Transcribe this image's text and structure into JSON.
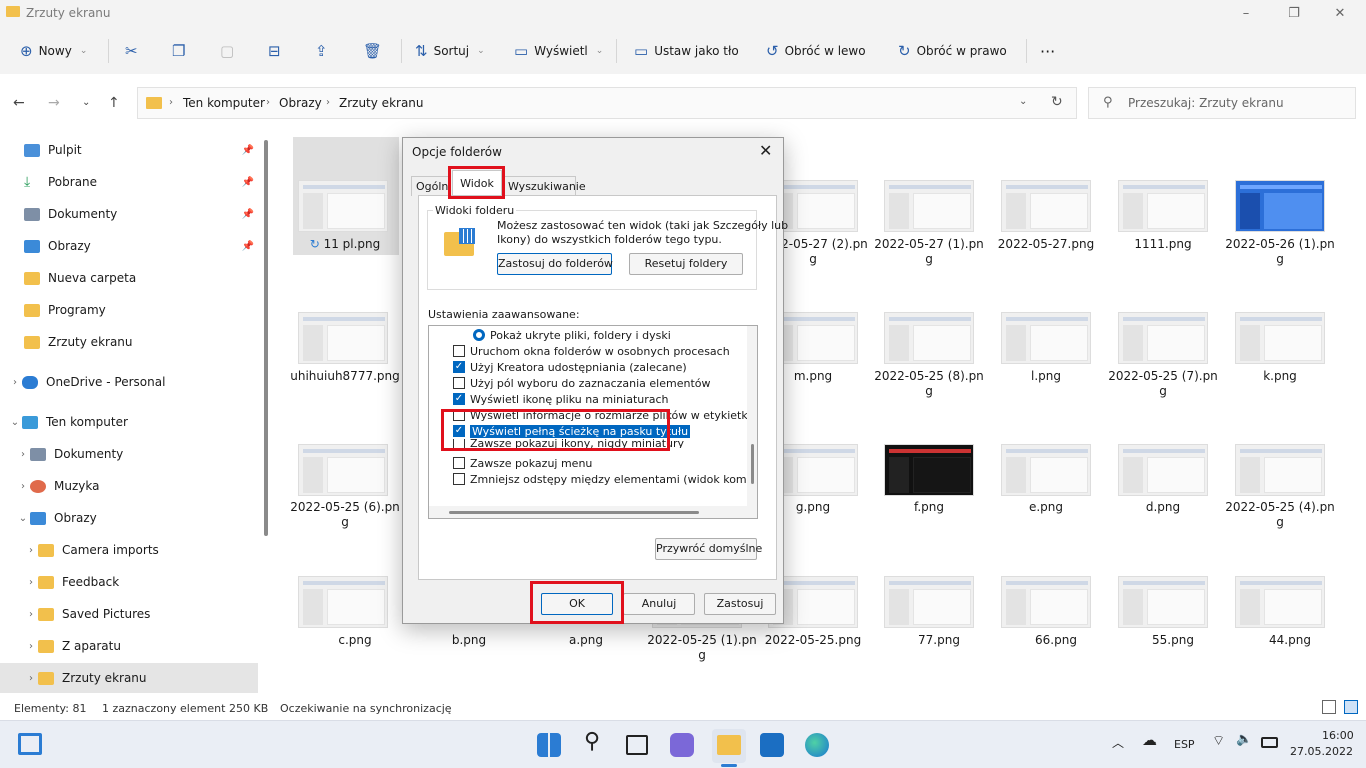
{
  "window": {
    "title": "Zrzuty ekranu",
    "minimize": "–",
    "maximize": "❐",
    "close": "✕"
  },
  "toolbar": {
    "new": "Nowy",
    "sort": "Sortuj",
    "view": "Wyświetl",
    "set_bg": "Ustaw jako tło",
    "rot_left": "Obróć w lewo",
    "rot_right": "Obróć w prawo",
    "more": "···"
  },
  "address": {
    "crumbs": [
      "Ten komputer",
      "Obrazy",
      "Zrzuty ekranu"
    ],
    "search_placeholder": "Przeszukaj: Zrzuty ekranu"
  },
  "sidebar": {
    "items": [
      "Pulpit",
      "Pobrane",
      "Dokumenty",
      "Obrazy",
      "Nueva carpeta",
      "Programy",
      "Zrzuty ekranu",
      "OneDrive - Personal",
      "Ten komputer",
      "Dokumenty",
      "Muzyka",
      "Obrazy",
      "Camera imports",
      "Feedback",
      "Saved Pictures",
      "Z aparatu",
      "Zrzuty ekranu"
    ]
  },
  "files": {
    "row1": [
      "11 pl.png",
      "2022-05-27 (2).png",
      "2022-05-27 (1).png",
      "2022-05-27.png",
      "1111.png",
      "2022-05-26 (1).png"
    ],
    "row2": [
      "uhihuiuh8777.png",
      "m.png",
      "2022-05-25 (8).png",
      "l.png",
      "2022-05-25 (7).png",
      "k.png"
    ],
    "row3": [
      "2022-05-25 (6).png",
      "g.png",
      "f.png",
      "e.png",
      "d.png",
      "2022-05-25 (4).png"
    ],
    "row4": [
      "c.png",
      "b.png",
      "a.png",
      "2022-05-25 (1).png",
      "2022-05-25.png",
      "77.png",
      "66.png",
      "55.png",
      "44.png"
    ]
  },
  "status": {
    "count": "Elementy: 81",
    "selected": "1 zaznaczony element",
    "size": "250 KB",
    "sync": "Oczekiwanie na synchronizację"
  },
  "dialog": {
    "title": "Opcje folderów",
    "tabs": [
      "Ogólne",
      "Widok",
      "Wyszukiwanie"
    ],
    "group_title": "Widoki folderu",
    "group_text1": "Możesz zastosować ten widok (taki jak Szczegóły lub",
    "group_text2": "Ikony) do wszystkich folderów tego typu.",
    "apply_folders": "Zastosuj do folderów",
    "reset_folders": "Resetuj foldery",
    "advanced_label": "Ustawienia zaawansowane:",
    "options": [
      "Pokaż ukryte pliki, foldery i dyski",
      "Uruchom okna folderów w osobnych procesach",
      "Użyj Kreatora udostępniania (zalecane)",
      "Użyj pól wyboru do zaznaczania elementów",
      "Wyświetl ikonę pliku na miniaturach",
      "Wyświetl informacje o rozmiarze plików w etykietkach folderów",
      "Wyświetl pełną ścieżkę na pasku tytułu",
      "Zawsze pokazuj ikony, nigdy miniatury",
      "Zawsze pokazuj menu",
      "Zmniejsz odstępy między elementami (widok kompaktowy)"
    ],
    "restore": "Przywróć domyślne",
    "ok": "OK",
    "cancel": "Anuluj",
    "apply": "Zastosuj"
  },
  "taskbar": {
    "lang": "ESP",
    "time": "16:00",
    "date": "27.05.2022"
  }
}
